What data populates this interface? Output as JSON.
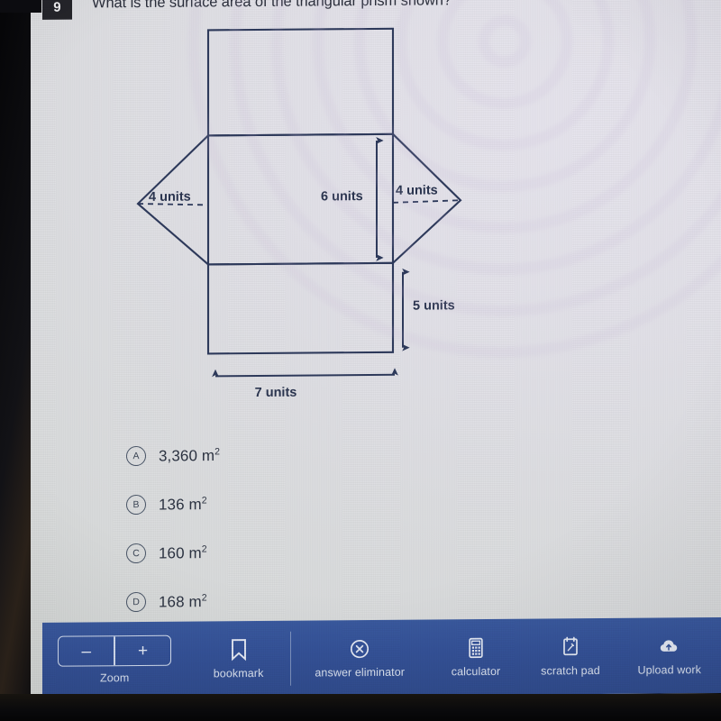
{
  "question": {
    "number": "9",
    "text": "What is the surface area of the triangular prism shown?"
  },
  "diagram": {
    "type": "net-of-triangular-prism",
    "labels": {
      "left_triangle_height": "4 units",
      "right_triangle_height": "4 units",
      "middle_rect_height": "6 units",
      "bottom_rect_height": "5 units",
      "base_width": "7 units"
    },
    "measurements": [
      {
        "name": "left-triangle-altitude",
        "value": 4,
        "unit": "units",
        "style": "dashed"
      },
      {
        "name": "right-triangle-altitude",
        "value": 4,
        "unit": "units",
        "style": "dashed"
      },
      {
        "name": "middle-rectangle-height",
        "value": 6,
        "unit": "units",
        "style": "double-arrow"
      },
      {
        "name": "bottom-rectangle-height",
        "value": 5,
        "unit": "units",
        "style": "double-arrow"
      },
      {
        "name": "net-width",
        "value": 7,
        "unit": "units",
        "style": "double-arrow"
      }
    ],
    "stroke_color": "#2e3a5c"
  },
  "answers": {
    "options": [
      {
        "letter": "A",
        "value": "3,360 m",
        "exponent": "2"
      },
      {
        "letter": "B",
        "value": "136 m",
        "exponent": "2"
      },
      {
        "letter": "C",
        "value": "160 m",
        "exponent": "2"
      },
      {
        "letter": "D",
        "value": "168 m",
        "exponent": "2"
      }
    ]
  },
  "toolbar": {
    "zoom": {
      "label": "Zoom",
      "minus": "–",
      "plus": "+",
      "icon": "zoom-minus-plus-icon"
    },
    "bookmark": {
      "label": "bookmark",
      "icon": "bookmark-icon"
    },
    "answer_eliminator": {
      "label": "answer eliminator",
      "icon": "circle-x-icon"
    },
    "calculator": {
      "label": "calculator",
      "icon": "calculator-icon"
    },
    "scratch_pad": {
      "label": "scratch pad",
      "icon": "scratch-pad-icon"
    },
    "upload_work": {
      "label": "Upload work",
      "icon": "cloud-upload-icon"
    },
    "background_color": "#35539a"
  },
  "theme": {
    "page_background": "#e3e3e7",
    "text_color": "#2c3342",
    "badge_background": "#24242a"
  }
}
